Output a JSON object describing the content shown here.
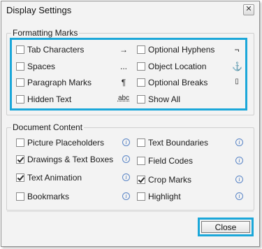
{
  "dialog": {
    "title": "Display Settings",
    "close_glyph": "✕"
  },
  "formatting": {
    "legend": "Formatting Marks",
    "left": [
      {
        "label": "Tab Characters",
        "checked": false,
        "symbol": "→"
      },
      {
        "label": "Spaces",
        "checked": false,
        "symbol": "..."
      },
      {
        "label": "Paragraph Marks",
        "checked": false,
        "symbol": "¶"
      },
      {
        "label": "Hidden Text",
        "checked": false,
        "symbol": "abc"
      }
    ],
    "right": [
      {
        "label": "Optional Hyphens",
        "checked": false,
        "symbol": "¬"
      },
      {
        "label": "Object Location",
        "checked": false,
        "symbol": "⚓"
      },
      {
        "label": "Optional Breaks",
        "checked": false,
        "symbol": "▯"
      },
      {
        "label": "Show All",
        "checked": false,
        "symbol": ""
      }
    ]
  },
  "document": {
    "legend": "Document Content",
    "info_glyph": "i",
    "left": [
      {
        "label": "Picture Placeholders",
        "checked": false
      },
      {
        "label": "Drawings & Text Boxes",
        "checked": true
      },
      {
        "label": "Text Animation",
        "checked": true
      },
      {
        "label": "Bookmarks",
        "checked": false
      }
    ],
    "right": [
      {
        "label": "Text Boundaries",
        "checked": false
      },
      {
        "label": "Field Codes",
        "checked": false
      },
      {
        "label": "Crop Marks",
        "checked": true
      },
      {
        "label": "Highlight",
        "checked": false
      }
    ]
  },
  "footer": {
    "close_label": "Close"
  },
  "colors": {
    "highlight": "#1ba7d9",
    "dialog_bg": "#f3f3f3",
    "info_icon": "#3d6fb8"
  }
}
